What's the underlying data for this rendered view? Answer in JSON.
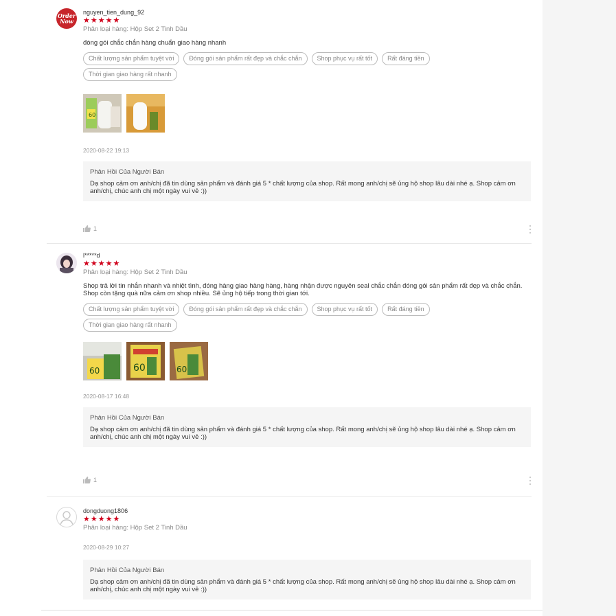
{
  "reviews": [
    {
      "username": "nguyen_tien_dung_92",
      "avatar_text": "Order Now",
      "stars": "★★★★★",
      "variation": "Phân loại hàng: Hộp Set 2 Tinh Dầu",
      "comment": "đóng gói chắc chắn hàng chuẩn giao hàng nhanh",
      "tags": [
        "Chất lượng sản phẩm tuyệt vời",
        "Đóng gói sản phẩm rất đẹp và chắc chắn",
        "Shop phục vụ rất tốt",
        "Rất đáng tiền",
        "Thời gian giao hàng rất nhanh"
      ],
      "image_count": 2,
      "timestamp": "2020-08-22 19:13",
      "reply_title": "Phản Hồi Của Người Bán",
      "reply_text": "Dạ shop cảm ơn anh/chị đã tin dùng sản phẩm và đánh giá 5 * chất lượng của shop. Rất mong anh/chị sẽ ủng hộ shop lâu dài nhé ạ. Shop cảm ơn anh/chị, chúc anh chị một ngày vui vẻ :))",
      "likes": "1"
    },
    {
      "username": "l*****d",
      "stars": "★★★★★",
      "variation": "Phân loại hàng: Hộp Set 2 Tinh Dầu",
      "comment": "Shop trả lời tin nhắn nhanh và nhiệt tình, đóng hàng giao hàng hàng, hàng nhận được nguyên seal chắc chắn đóng gói sản phẩm rất đẹp và chắc chắn. Shop còn tặng quà nữa cảm ơn shop nhiều. Sẽ ủng hộ tiếp trong thời gian tới.",
      "tags": [
        "Chất lượng sản phẩm tuyệt vời",
        "Đóng gói sản phẩm rất đẹp và chắc chắn",
        "Shop phục vụ rất tốt",
        "Rất đáng tiền",
        "Thời gian giao hàng rất nhanh"
      ],
      "image_count": 3,
      "timestamp": "2020-08-17 16:48",
      "reply_title": "Phản Hồi Của Người Bán",
      "reply_text": "Dạ shop cảm ơn anh/chị đã tin dùng sản phẩm và đánh giá 5 * chất lượng của shop. Rất mong anh/chị sẽ ủng hộ shop lâu dài nhé ạ. Shop cảm ơn anh/chị, chúc anh chị một ngày vui vẻ :))",
      "likes": "1"
    },
    {
      "username": "dongduong1806",
      "stars": "★★★★★",
      "variation": "Phân loại hàng: Hộp Set 2 Tinh Dầu",
      "timestamp": "2020-08-29 10:27",
      "reply_title": "Phản Hồi Của Người Bán",
      "reply_text": "Dạ shop cảm ơn anh/chị đã tin dùng sản phẩm và đánh giá 5 * chất lượng của shop. Rất mong anh/chị sẽ ủng hộ shop lâu dài nhé ạ. Shop cảm ơn anh/chị, chúc anh chị một ngày vui vẻ :))"
    }
  ],
  "colors": {
    "star": "#d0011b",
    "reply_bg": "#f5f5f5",
    "sidebar_bg": "#f5f5f5"
  }
}
